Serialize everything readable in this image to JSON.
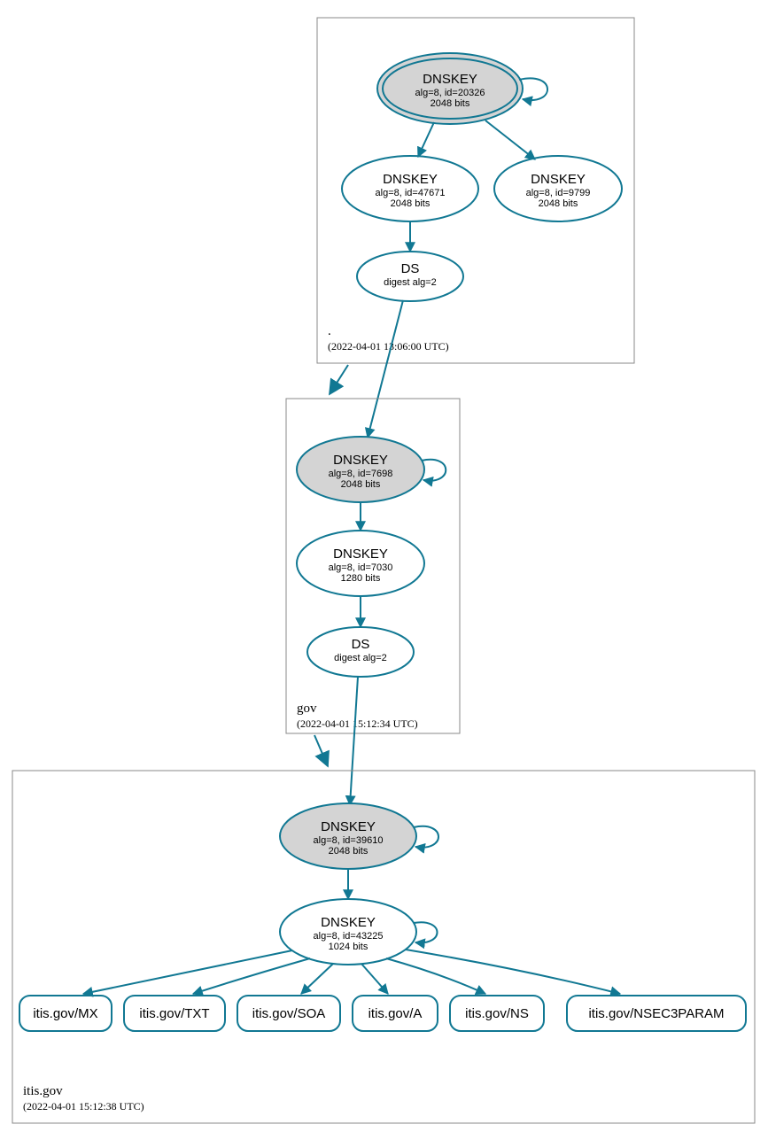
{
  "colors": {
    "accent": "#117893",
    "ksk_fill": "#d4d4d4"
  },
  "zones": {
    "root": {
      "label": ".",
      "timestamp": "(2022-04-01 13:06:00 UTC)"
    },
    "gov": {
      "label": "gov",
      "timestamp": "(2022-04-01 15:12:34 UTC)"
    },
    "itis": {
      "label": "itis.gov",
      "timestamp": "(2022-04-01 15:12:38 UTC)"
    }
  },
  "nodes": {
    "root_ksk": {
      "title": "DNSKEY",
      "l2": "alg=8, id=20326",
      "l3": "2048 bits"
    },
    "root_zsk1": {
      "title": "DNSKEY",
      "l2": "alg=8, id=47671",
      "l3": "2048 bits"
    },
    "root_zsk2": {
      "title": "DNSKEY",
      "l2": "alg=8, id=9799",
      "l3": "2048 bits"
    },
    "root_ds": {
      "title": "DS",
      "l2": "digest alg=2"
    },
    "gov_ksk": {
      "title": "DNSKEY",
      "l2": "alg=8, id=7698",
      "l3": "2048 bits"
    },
    "gov_zsk": {
      "title": "DNSKEY",
      "l2": "alg=8, id=7030",
      "l3": "1280 bits"
    },
    "gov_ds": {
      "title": "DS",
      "l2": "digest alg=2"
    },
    "itis_ksk": {
      "title": "DNSKEY",
      "l2": "alg=8, id=39610",
      "l3": "2048 bits"
    },
    "itis_zsk": {
      "title": "DNSKEY",
      "l2": "alg=8, id=43225",
      "l3": "1024 bits"
    },
    "rr_mx": {
      "label": "itis.gov/MX"
    },
    "rr_txt": {
      "label": "itis.gov/TXT"
    },
    "rr_soa": {
      "label": "itis.gov/SOA"
    },
    "rr_a": {
      "label": "itis.gov/A"
    },
    "rr_ns": {
      "label": "itis.gov/NS"
    },
    "rr_nsec3p": {
      "label": "itis.gov/NSEC3PARAM"
    }
  }
}
